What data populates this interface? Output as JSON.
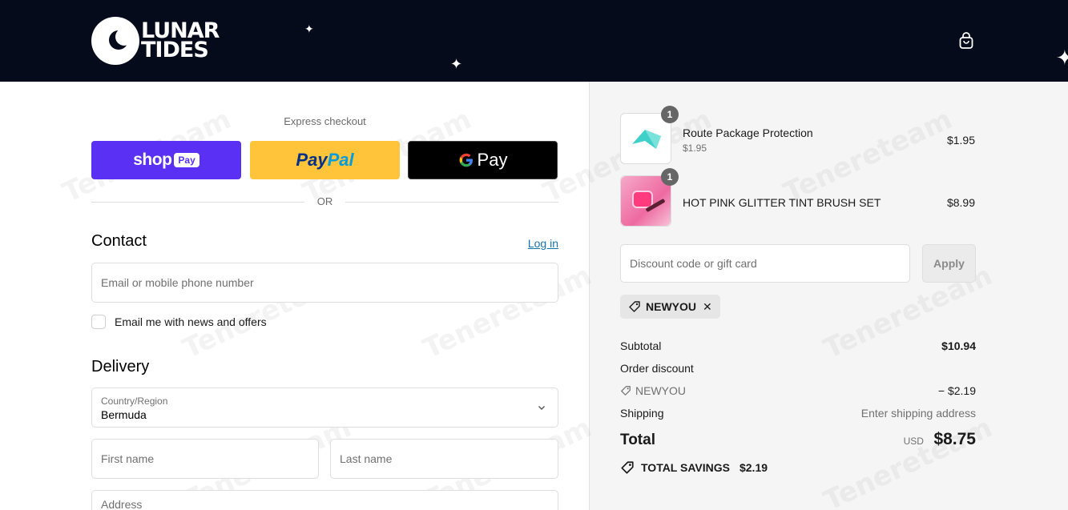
{
  "header": {
    "logo_line1": "LUNAR",
    "logo_line2": "TIDES"
  },
  "express": {
    "label": "Express checkout",
    "shop_label": "shop",
    "shop_pill": "Pay",
    "paypal_part1": "Pay",
    "paypal_part2": "Pal",
    "gpay_label": "Pay",
    "or_label": "OR"
  },
  "contact": {
    "title": "Contact",
    "login_label": "Log in",
    "email_placeholder": "Email or mobile phone number",
    "newsletter_label": "Email me with news and offers"
  },
  "delivery": {
    "title": "Delivery",
    "country_label": "Country/Region",
    "country_value": "Bermuda",
    "first_name_placeholder": "First name",
    "last_name_placeholder": "Last name",
    "address_placeholder": "Address"
  },
  "order": {
    "items": [
      {
        "name": "Route Package Protection",
        "sub": "$1.95",
        "price": "$1.95",
        "qty": "1"
      },
      {
        "name": "HOT PINK GLITTER TINT BRUSH SET",
        "price": "$8.99",
        "qty": "1"
      }
    ],
    "discount_placeholder": "Discount code or gift card",
    "apply_label": "Apply",
    "applied_code": "NEWYOU",
    "subtotal_label": "Subtotal",
    "subtotal_value": "$10.94",
    "order_discount_label": "Order discount",
    "discount_code": "NEWYOU",
    "discount_value": "− $2.19",
    "shipping_label": "Shipping",
    "shipping_value": "Enter shipping address",
    "total_label": "Total",
    "total_currency": "USD",
    "total_value": "$8.75",
    "savings_label": "TOTAL SAVINGS",
    "savings_value": "$2.19"
  },
  "watermark": "Tenereteam",
  "colors": {
    "header_bg": "#050b1a",
    "shop_pay": "#5a31f4",
    "paypal": "#ffc439",
    "link": "#1773b0",
    "summary_bg": "#f5f5f5"
  }
}
